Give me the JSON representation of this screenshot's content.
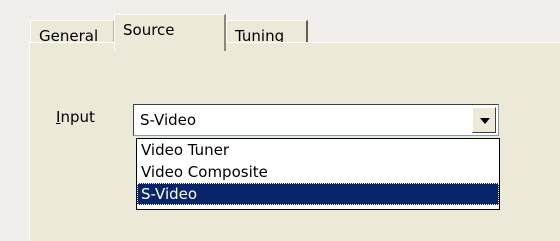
{
  "tabs": [
    {
      "label": "General"
    },
    {
      "label": "Source"
    },
    {
      "label": "Tuning"
    }
  ],
  "input": {
    "label_first": "I",
    "label_rest": "nput",
    "value": "S-Video",
    "options": [
      "Video Tuner",
      "Video Composite",
      "S-Video"
    ],
    "selected": "S-Video"
  },
  "colors": {
    "panel_bg": "#ece9d8",
    "selection_bg": "#0a246a",
    "page_bg": "#f2eeec"
  },
  "icons": {
    "dropdown_button": "chevron-down-icon"
  }
}
